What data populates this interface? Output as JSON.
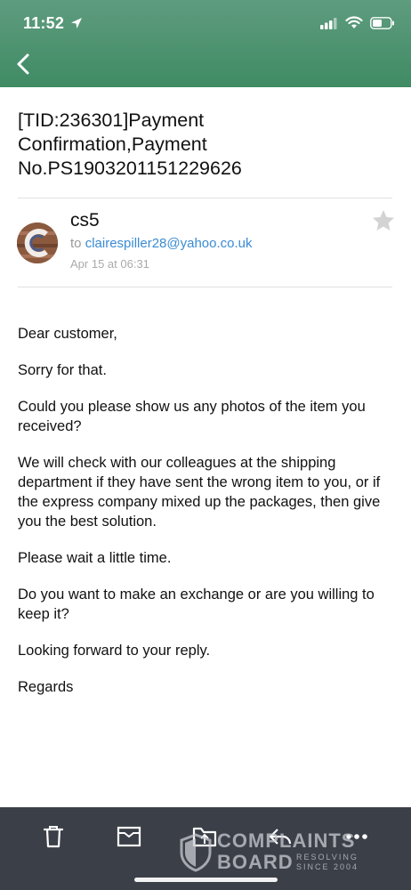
{
  "status_bar": {
    "time": "11:52"
  },
  "email": {
    "subject": "[TID:236301]Payment Confirmation,Payment No.PS1903201151229626",
    "sender": "cs5",
    "to_prefix": "to",
    "to_address": "clairespiller28@yahoo.co.uk",
    "date": "Apr 15 at 06:31",
    "body": [
      "Dear customer,",
      "Sorry for that.",
      "Could you please show us any photos of the item you received?",
      "We will check with our colleagues at the shipping department if they have sent the wrong item to you, or if the express company mixed up the packages, then give you the best solution.",
      "Please wait a little time.",
      "Do you want to make an exchange or are you willing to keep it?",
      "Looking forward to your reply.",
      "Regards"
    ]
  },
  "toolbar": {
    "icons": [
      "trash-icon",
      "archive-icon",
      "move-to-folder-icon",
      "reply-icon",
      "more-icon"
    ]
  },
  "watermark": {
    "line1": "COMPLAINTS",
    "line2": "BOARD",
    "tagline1": "RESOLVING",
    "tagline2": "SINCE 2004"
  },
  "colors": {
    "header": "#4a9470",
    "toolbar": "#3b3f48",
    "link": "#3a8bd4"
  }
}
